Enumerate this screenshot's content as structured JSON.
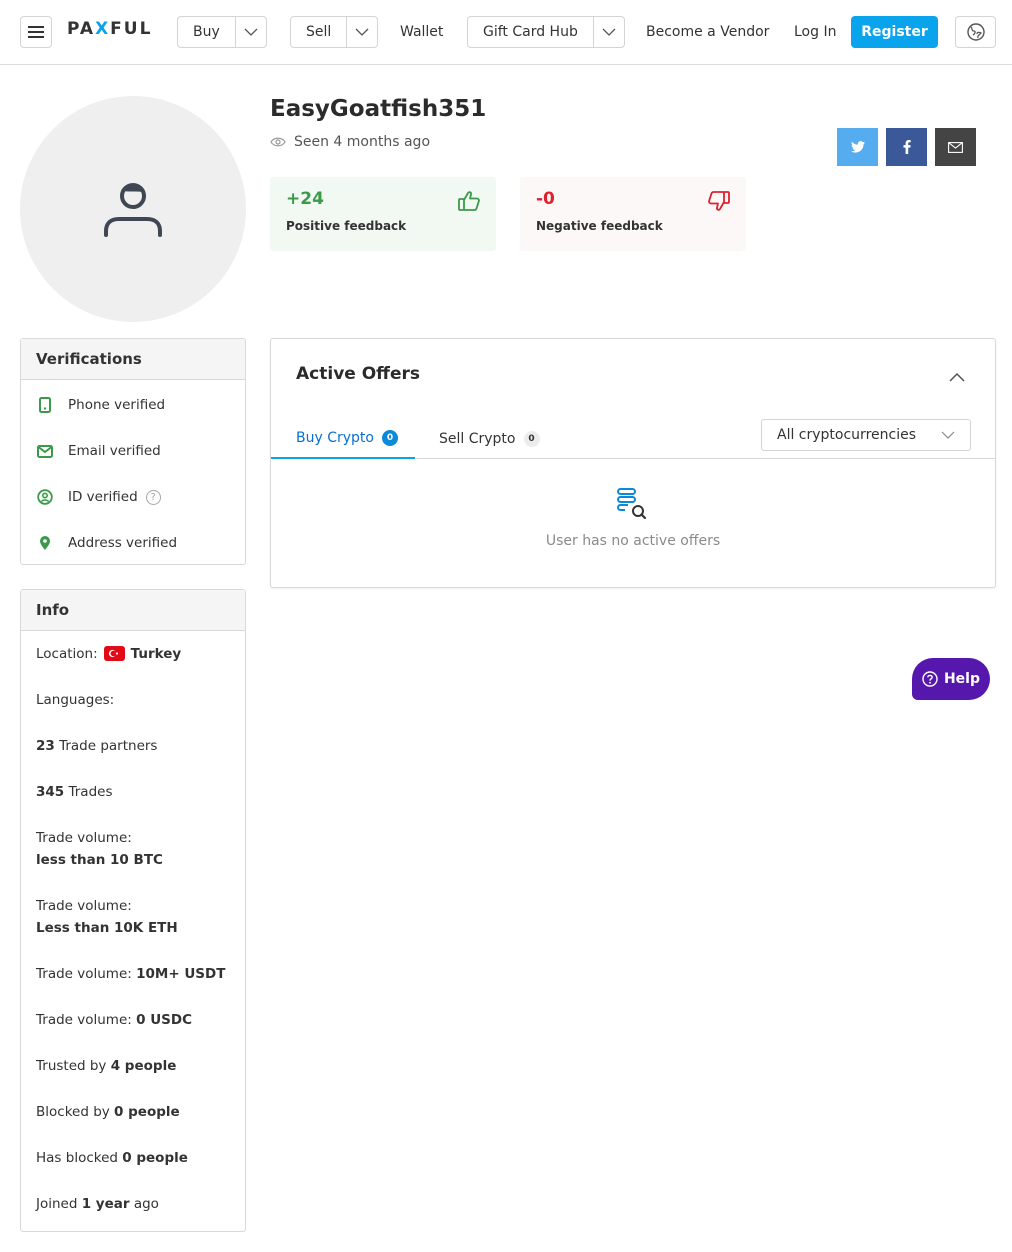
{
  "header": {
    "logo": {
      "pre": "PA",
      "x": "X",
      "post": "FUL"
    },
    "buy_label": "Buy",
    "sell_label": "Sell",
    "wallet_label": "Wallet",
    "gift_card_hub_label": "Gift Card Hub",
    "become_vendor_label": "Become a Vendor",
    "login_label": "Log In",
    "register_label": "Register",
    "icons": {
      "menu": "hamburger-icon",
      "dropdown": "chevron-down-icon",
      "language": "globe-icon"
    }
  },
  "profile": {
    "username": "EasyGoatfish351",
    "seen": "Seen 4 months ago",
    "avatar_icon": "user-icon",
    "social": [
      {
        "name": "twitter",
        "color": "#55acee"
      },
      {
        "name": "facebook",
        "color": "#3b5998"
      },
      {
        "name": "email",
        "color": "#444444"
      }
    ],
    "positive_feedback": {
      "value": "+24",
      "label": "Positive feedback",
      "color": "#3b9a4a"
    },
    "negative_feedback": {
      "value": "-0",
      "label": "Negative feedback",
      "color": "#e0202c"
    }
  },
  "verifications": {
    "title": "Verifications",
    "items": [
      {
        "label": "Phone verified",
        "icon": "phone-icon"
      },
      {
        "label": "Email verified",
        "icon": "envelope-icon"
      },
      {
        "label": "ID verified",
        "icon": "id-user-icon",
        "help": "?"
      },
      {
        "label": "Address verified",
        "icon": "location-pin-icon"
      }
    ]
  },
  "info": {
    "title": "Info",
    "location_label": "Location:",
    "location_value": "Turkey",
    "languages_label": "Languages:",
    "trade_partners": {
      "value": "23",
      "label": " Trade partners"
    },
    "trades": {
      "value": "345",
      "label": " Trades"
    },
    "trade_volume_label": "Trade volume:",
    "volume_btc": "less than 10 BTC",
    "volume_eth": "Less than 10K ETH",
    "volume_usdt": "10M+ USDT",
    "volume_usdc": "0 USDC",
    "trusted": {
      "label": "Trusted by ",
      "value": "4 people"
    },
    "blocked_by": {
      "label": "Blocked by ",
      "value": "0 people"
    },
    "has_blocked": {
      "label": "Has blocked ",
      "value": "0 people"
    },
    "joined": {
      "label": "Joined ",
      "value": "1 year",
      "suffix": " ago"
    }
  },
  "offers": {
    "title": "Active Offers",
    "tabs": [
      {
        "label": "Buy Crypto",
        "count": "0",
        "active": true
      },
      {
        "label": "Sell Crypto",
        "count": "0",
        "active": false
      }
    ],
    "crypto_filter": "All cryptocurrencies",
    "empty_text": "User has no active offers"
  },
  "help_button": {
    "label": "Help"
  }
}
